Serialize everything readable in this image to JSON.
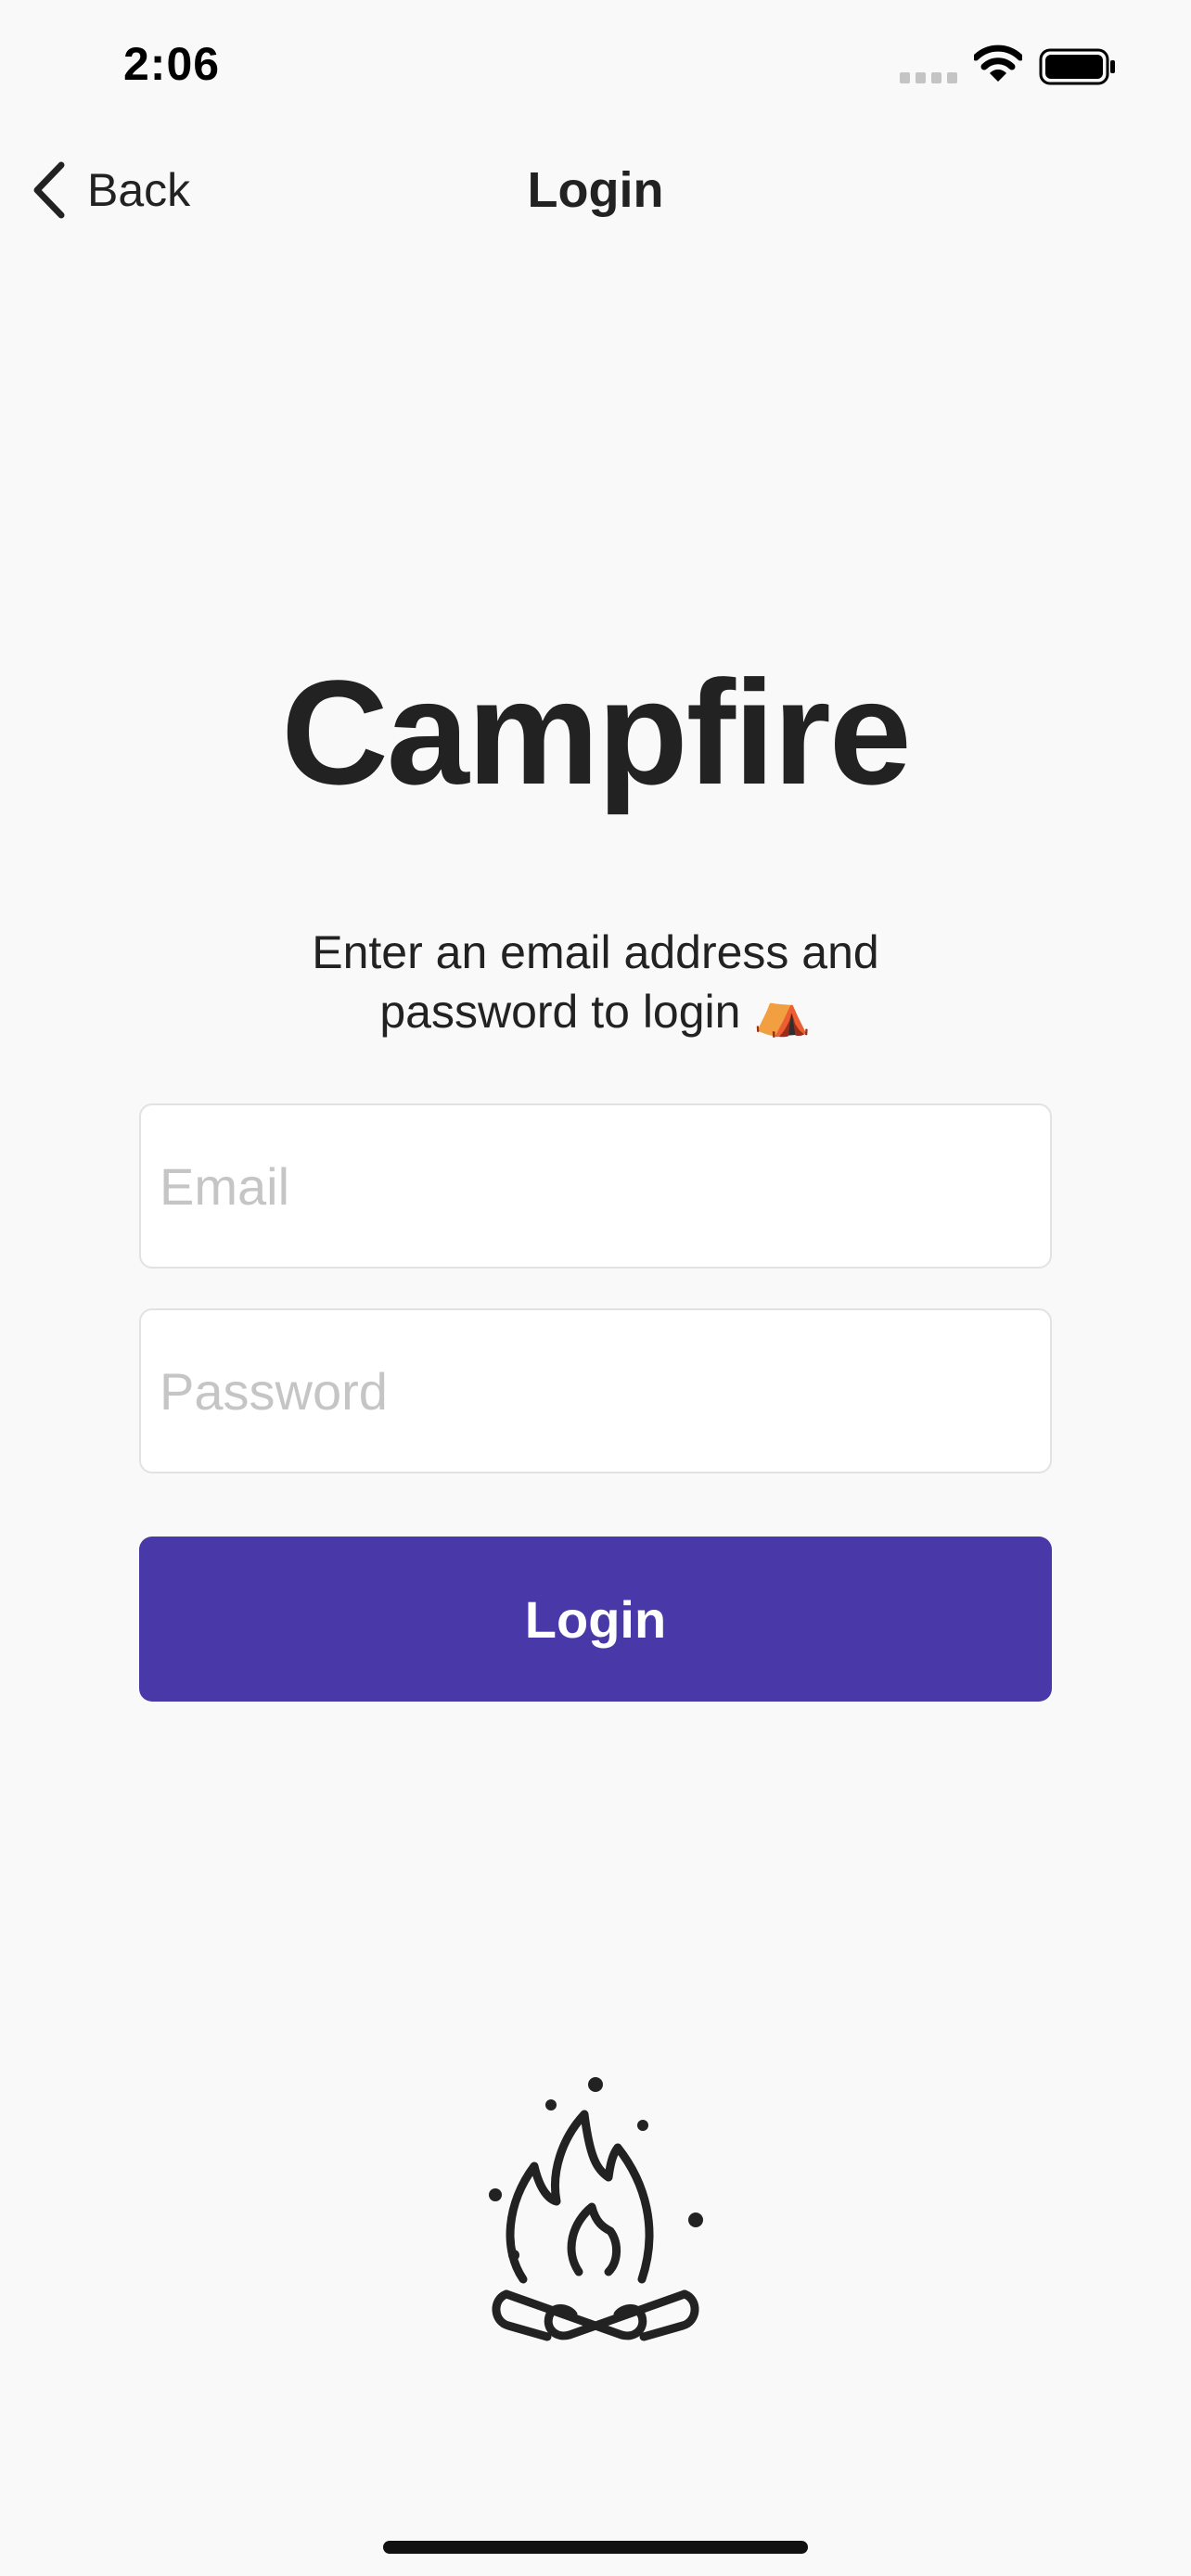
{
  "status_bar": {
    "time": "2:06",
    "icons": [
      "signal-icon",
      "wifi-icon",
      "battery-icon"
    ]
  },
  "nav": {
    "back_label": "Back",
    "title": "Login"
  },
  "main": {
    "app_title": "Campfire",
    "subtitle_line1": "Enter an email address and",
    "subtitle_line2": "password to login",
    "subtitle_emoji": "⛺",
    "email_placeholder": "Email",
    "email_value": "",
    "password_placeholder": "Password",
    "password_value": "",
    "login_label": "Login",
    "illustration": "campfire-icon"
  },
  "colors": {
    "background": "#f9f9f9",
    "accent": "#4938a8",
    "text": "#222222",
    "placeholder": "#c5c5c5"
  }
}
